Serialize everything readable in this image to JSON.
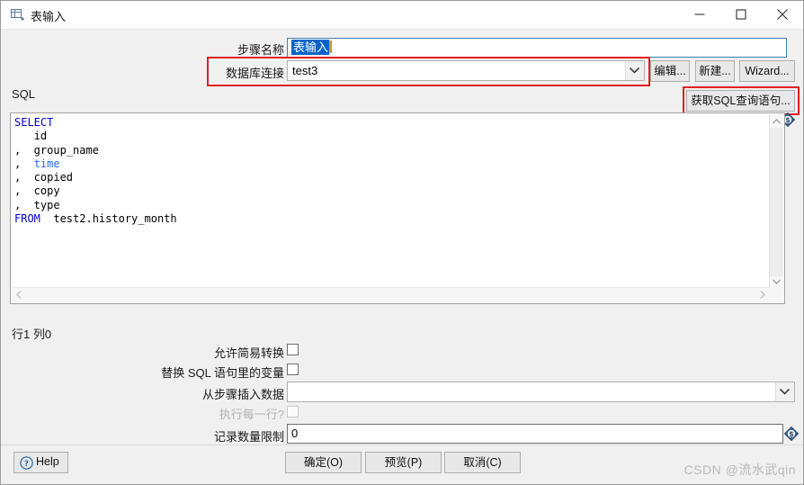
{
  "window": {
    "title": "表输入",
    "icon": "table-input-icon",
    "controls": {
      "minimize": "minimize-icon",
      "maximize": "maximize-icon",
      "close": "close-icon"
    }
  },
  "form": {
    "step_name": {
      "label": "步骤名称",
      "value": "表输入",
      "selected": true
    },
    "connection": {
      "label": "数据库连接",
      "value": "test3",
      "options": [
        "test3"
      ]
    },
    "connection_buttons": {
      "edit": "编辑...",
      "new": "新建...",
      "wizard": "Wizard..."
    }
  },
  "sql": {
    "section_label": "SQL",
    "get_sql_button": "获取SQL查询语句...",
    "text": "SELECT\n  id\n, group_name\n, time\n, copied\n, copy\n, type\nFROM test2.history_month",
    "lines": [
      {
        "keyword": "SELECT",
        "rest": ""
      },
      {
        "keyword": "",
        "rest": "  id"
      },
      {
        "keyword": "",
        "rest": ", group_name"
      },
      {
        "keyword": "",
        "rest": ", ",
        "type": "time"
      },
      {
        "keyword": "",
        "rest": ", copied"
      },
      {
        "keyword": "",
        "rest": ", copy"
      },
      {
        "keyword": "",
        "rest": ", type"
      },
      {
        "keyword": "FROM",
        "rest": " test2.history_month"
      }
    ],
    "variable_icon": "variable-diamond-icon",
    "status": "行1 列0"
  },
  "options": {
    "allow_lazy_conversion": {
      "label": "允许简易转换",
      "checked": false
    },
    "replace_variables": {
      "label": "替换 SQL 语句里的变量",
      "checked": false
    },
    "insert_data_from_step": {
      "label": "从步骤插入数据",
      "value": "",
      "options": []
    },
    "execute_for_each_row": {
      "label": "执行每一行?",
      "checked": false,
      "disabled": true
    },
    "limit_size": {
      "label": "记录数量限制",
      "value": "0",
      "variable_icon": "variable-diamond-icon"
    }
  },
  "footer": {
    "help": "Help",
    "help_icon": "help-question-icon",
    "ok": "确定(O)",
    "preview": "预览(P)",
    "cancel": "取消(C)"
  },
  "watermark": "CSDN @流水武qin",
  "colors": {
    "annotation_red": "#e02020",
    "selection_blue": "#0a64c8",
    "keyword_blue": "#0000d0",
    "focus_border": "#3c7fb1"
  }
}
